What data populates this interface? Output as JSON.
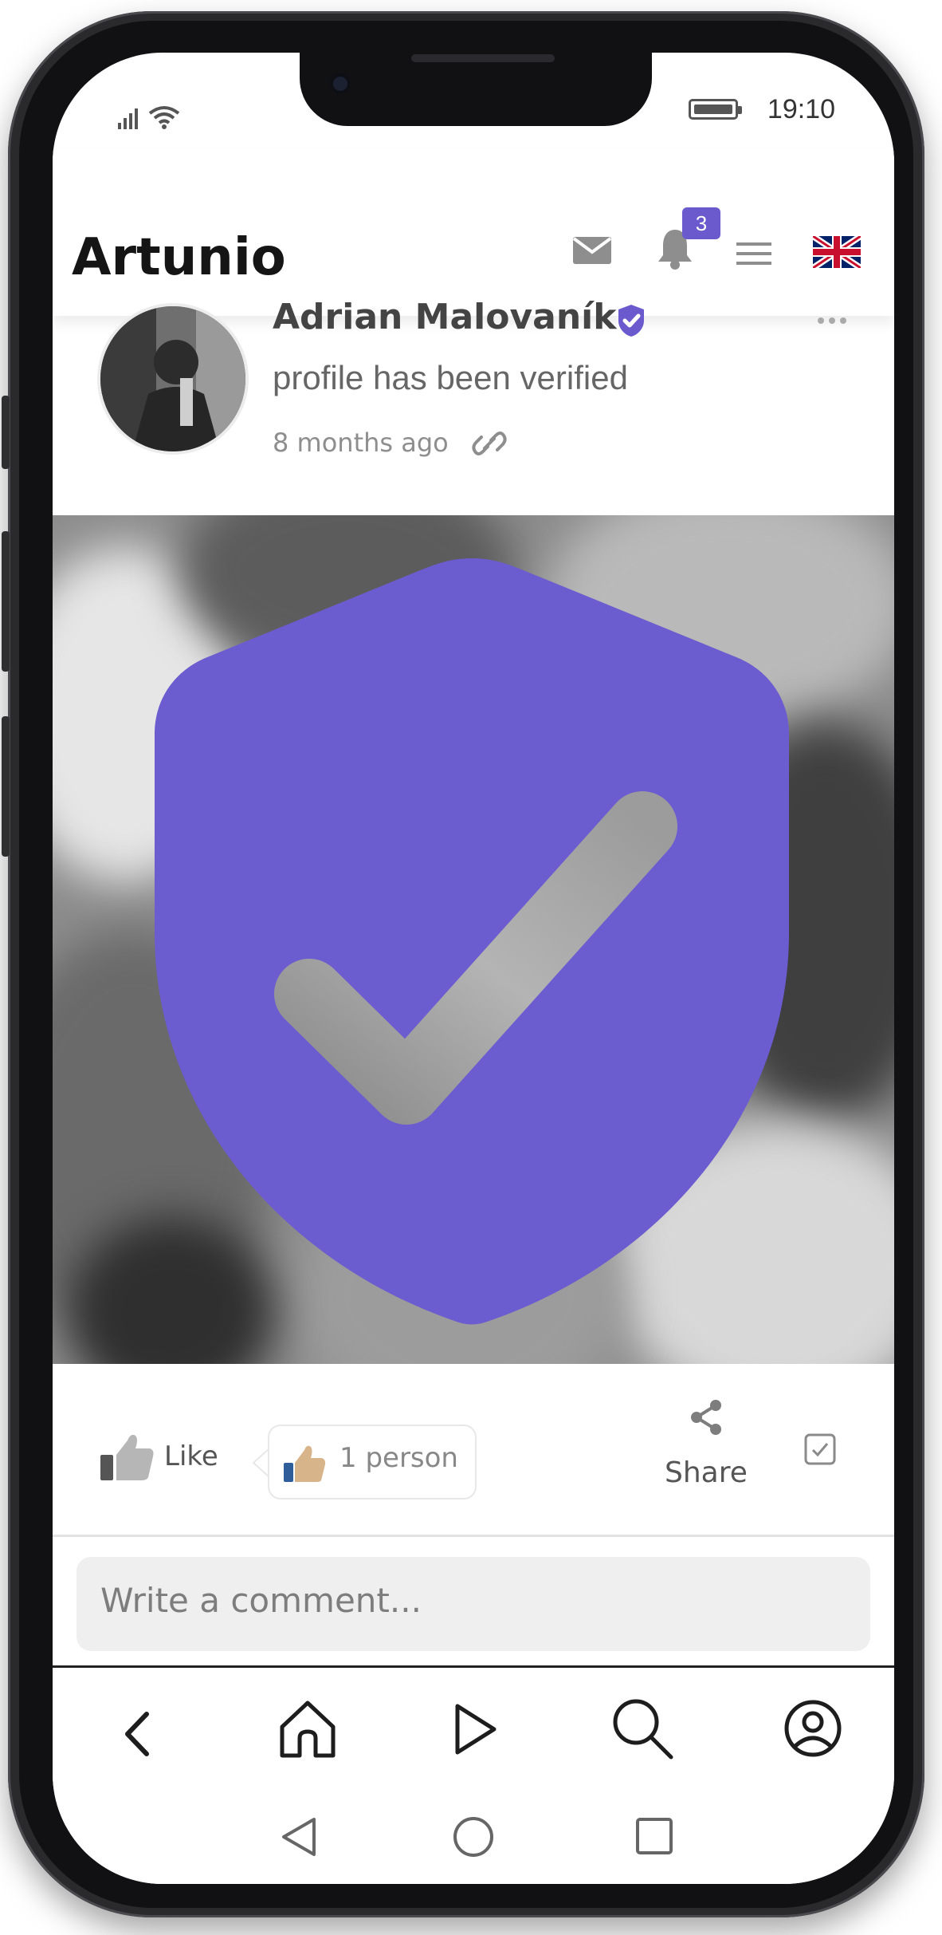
{
  "app": {
    "name": "Artunio"
  },
  "status_bar": {
    "time": "19:10"
  },
  "header": {
    "brand": "Artunio",
    "notification_count": "3",
    "icons": [
      "mail-icon",
      "bell-icon",
      "menu-icon",
      "uk-flag-icon"
    ]
  },
  "post": {
    "author": "Adrian Malovaník",
    "activity": "profile has been verified",
    "time_ago": "8 months ago",
    "image_icon": "shield-check-icon"
  },
  "actions": {
    "like_label": "Like",
    "likes_summary": "1 person",
    "share_label": "Share"
  },
  "comment": {
    "placeholder": "Write a comment..."
  },
  "nav": {
    "icons": [
      "back-icon",
      "home-icon",
      "play-icon",
      "search-icon",
      "profile-icon"
    ]
  },
  "system_nav": {
    "icons": [
      "back-triangle-icon",
      "home-circle-icon",
      "recents-square-icon"
    ]
  },
  "colors": {
    "accent": "#6a5acd",
    "shield": "#6b5ccf"
  }
}
